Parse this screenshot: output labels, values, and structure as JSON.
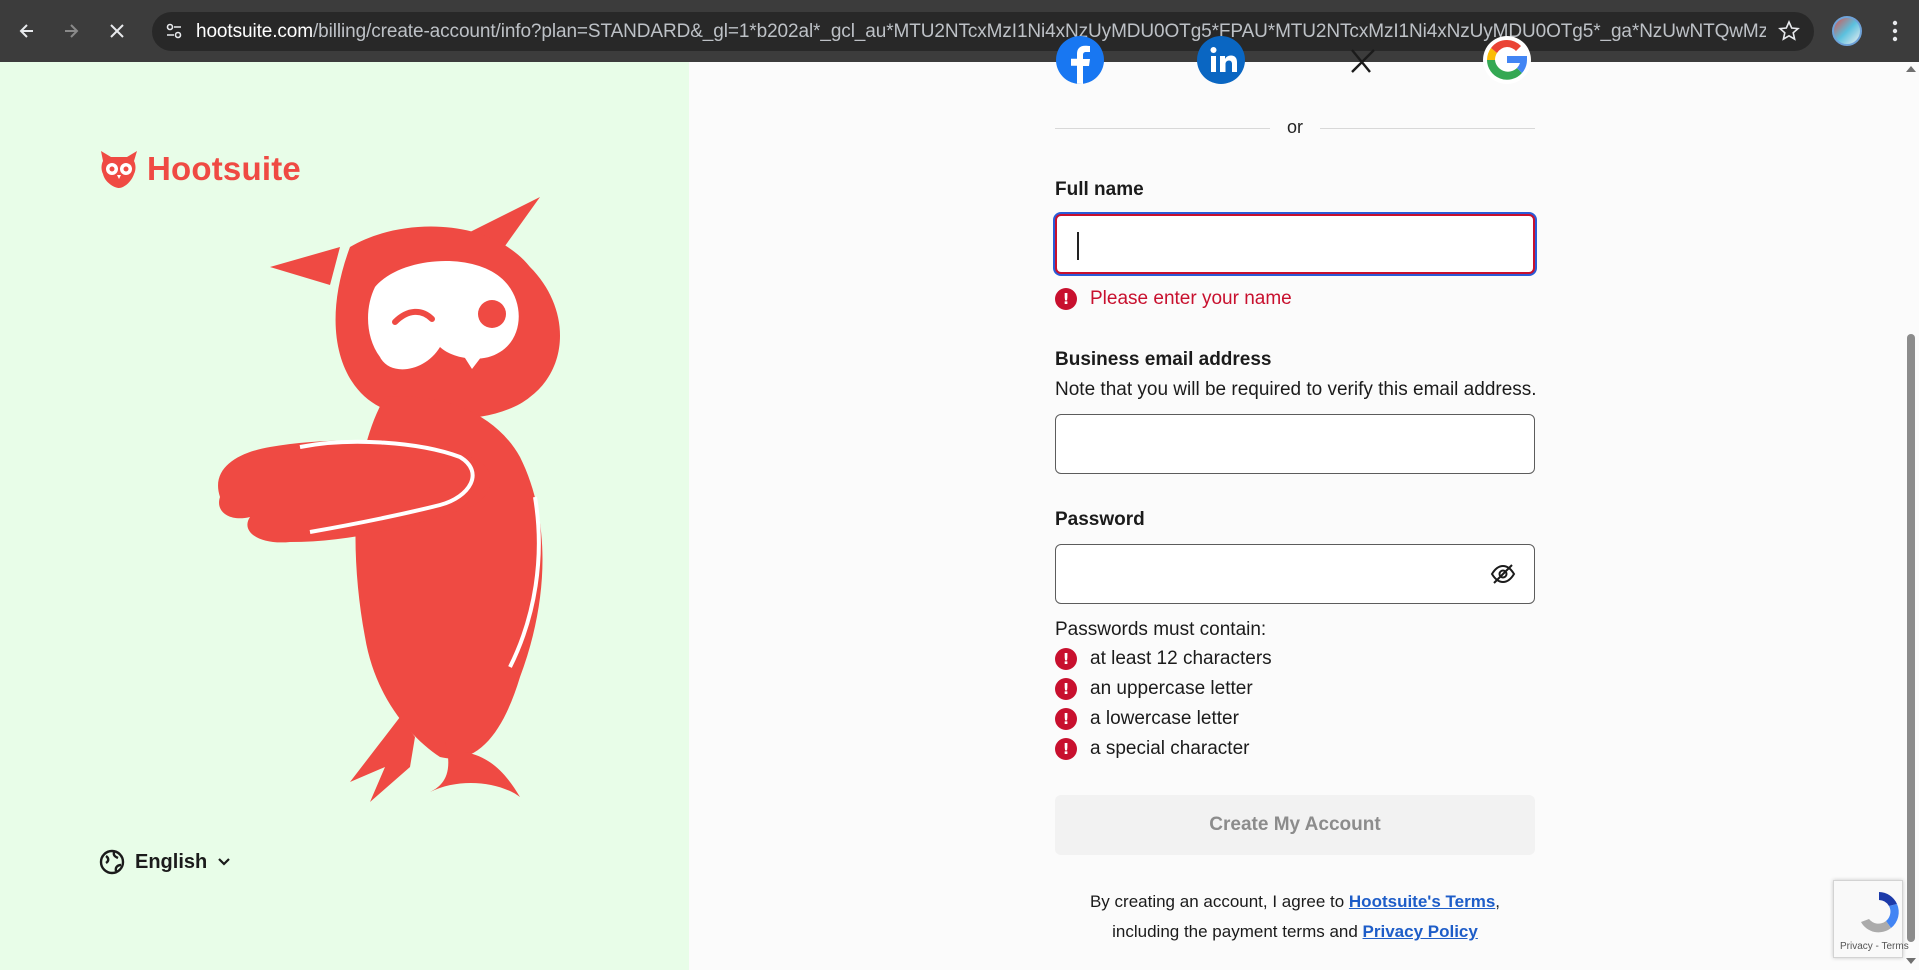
{
  "browser": {
    "url_host": "hootsuite.com",
    "url_path": "/billing/create-account/info?plan=STANDARD&_gl=1*b202al*_gcl_au*MTU2NTcxMzI1Ni4xNzUyMDU0OTg5*FPAU*MTU2NTcxMzI1Ni4xNzUyMDU0OTg5*_ga*NzUwNTQwMzQ5LjE3NTIwN..."
  },
  "brand": {
    "name": "Hootsuite",
    "accent": "#ef4a43",
    "panel_bg": "#e8fde8"
  },
  "language": {
    "selected": "English"
  },
  "social_icons": [
    "facebook-icon",
    "linkedin-icon",
    "x-icon",
    "google-icon"
  ],
  "divider_text": "or",
  "form": {
    "full_name": {
      "label": "Full name",
      "value": "",
      "error": "Please enter your name"
    },
    "email": {
      "label": "Business email address",
      "note": "Note that you will be required to verify this email address.",
      "value": ""
    },
    "password": {
      "label": "Password",
      "value": "",
      "requirements_title": "Passwords must contain:",
      "requirements": [
        "at least 12 characters",
        "an uppercase letter",
        "a lowercase letter",
        "a special character"
      ]
    },
    "submit_label": "Create My Account"
  },
  "terms": {
    "prefix": "By creating an account, I agree to ",
    "terms_link": "Hootsuite's Terms",
    "middle": ", including the payment terms and ",
    "privacy_link": "Privacy Policy"
  },
  "recaptcha": {
    "links": "Privacy - Terms"
  },
  "colors": {
    "error": "#c8102e",
    "link": "#1e5dc8",
    "focus_ring": "#2a5bd7"
  }
}
